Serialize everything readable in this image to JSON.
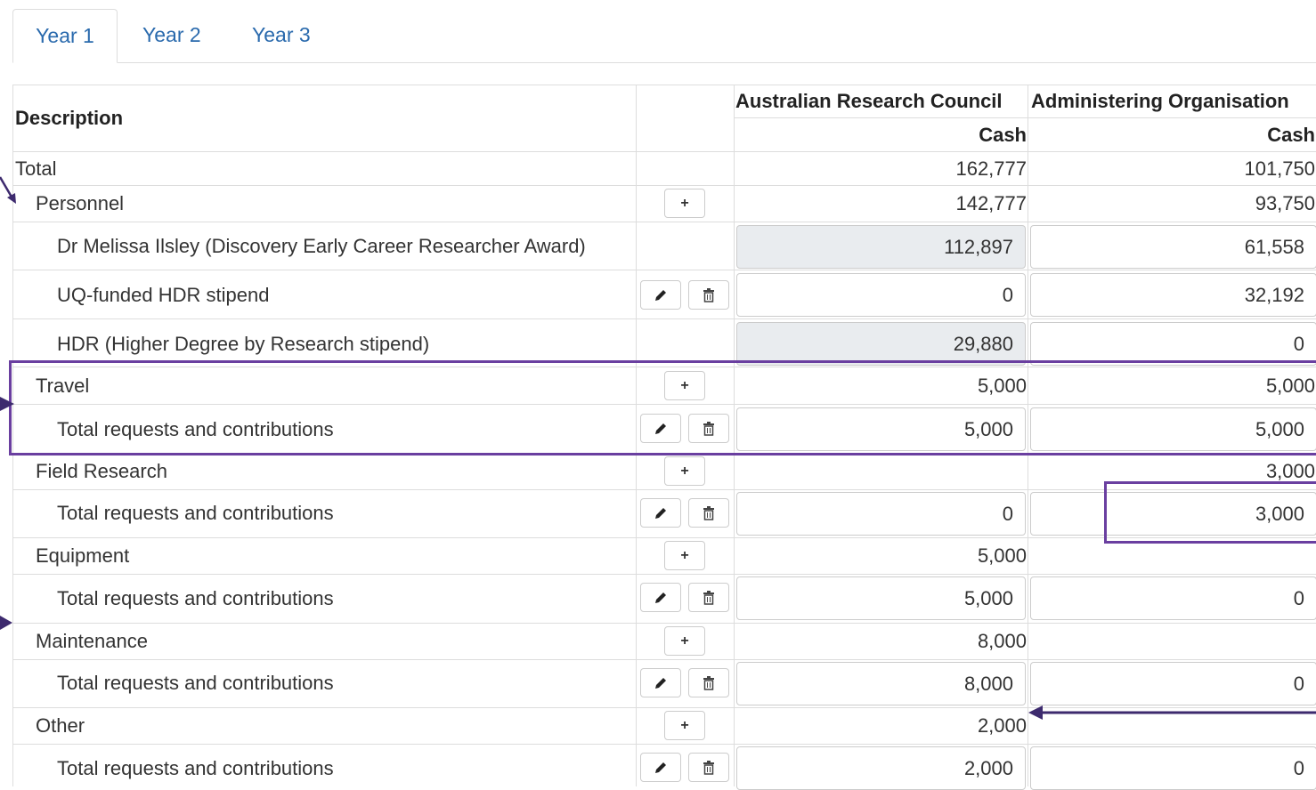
{
  "tabs": [
    {
      "label": "Year 1",
      "active": true
    },
    {
      "label": "Year 2",
      "active": false
    },
    {
      "label": "Year 3",
      "active": false
    }
  ],
  "header": {
    "description": "Description",
    "org1": "Australian Research Council",
    "org2": "Administering Organisation",
    "cash1": "Cash",
    "cash2": "Cash"
  },
  "rows": {
    "total": {
      "label": "Total",
      "v1": "162,777",
      "v2": "101,750"
    },
    "personnel": {
      "label": "Personnel",
      "v1": "142,777",
      "v2": "93,750",
      "add": "+"
    },
    "melissa": {
      "label": "Dr Melissa Ilsley (Discovery Early Career Researcher Award)",
      "v1": "112,897",
      "v2": "61,558"
    },
    "uq": {
      "label": "UQ-funded HDR stipend",
      "v1": "0",
      "v2": "32,192"
    },
    "hdr": {
      "label": "HDR (Higher Degree by Research stipend)",
      "v1": "29,880",
      "v2": "0"
    },
    "travel": {
      "label": "Travel",
      "v1": "5,000",
      "v2": "5,000",
      "add": "+"
    },
    "travel_total": {
      "label": "Total requests and contributions",
      "v1": "5,000",
      "v2": "5,000"
    },
    "field": {
      "label": "Field Research",
      "v1": "",
      "v2": "3,000",
      "add": "+"
    },
    "field_total": {
      "label": "Total requests and contributions",
      "v1": "0",
      "v2": "3,000"
    },
    "equipment": {
      "label": "Equipment",
      "v1": "5,000",
      "v2": "",
      "add": "+"
    },
    "equipment_total": {
      "label": "Total requests and contributions",
      "v1": "5,000",
      "v2": "0"
    },
    "maintenance": {
      "label": "Maintenance",
      "v1": "8,000",
      "v2": "",
      "add": "+"
    },
    "maintenance_total": {
      "label": "Total requests and contributions",
      "v1": "8,000",
      "v2": "0"
    },
    "other": {
      "label": "Other",
      "v1": "2,000",
      "v2": "",
      "add": "+"
    },
    "other_total": {
      "label": "Total requests and contributions",
      "v1": "2,000",
      "v2": "0"
    }
  },
  "icons": {
    "edit": "pencil-icon",
    "delete": "trash-icon",
    "add": "plus-icon"
  },
  "colors": {
    "tab_link": "#2a6aad",
    "readonly_fill": "#e9ecef",
    "annotation": "#6a3fa0"
  }
}
